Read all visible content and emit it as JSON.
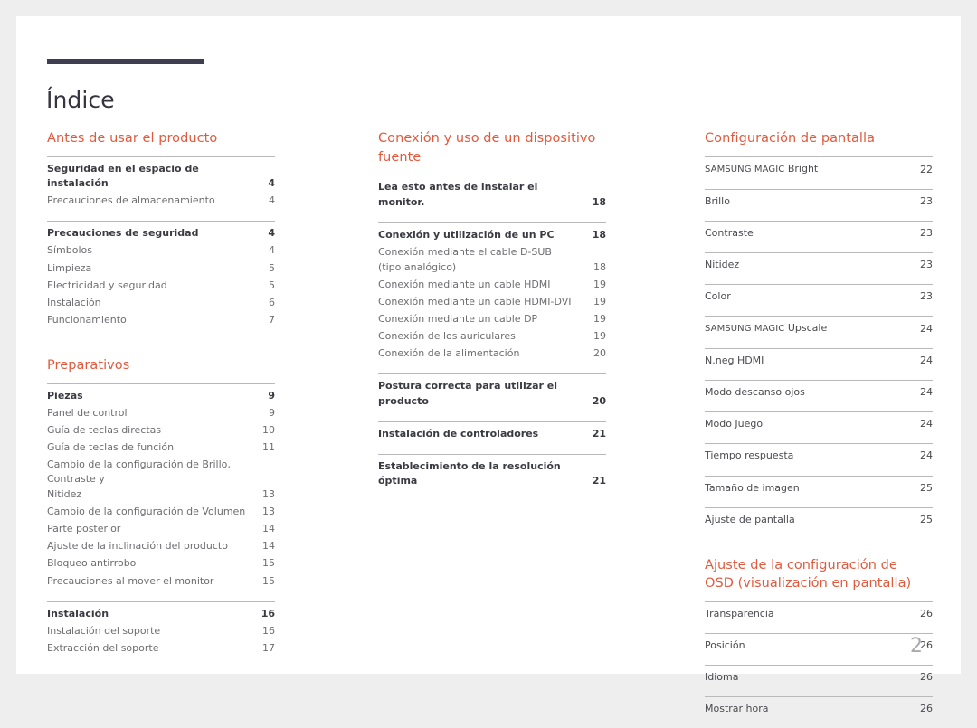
{
  "document": {
    "title": "Índice",
    "page_number": "2",
    "accent_color": "#e15a3e",
    "rule_color": "#3f3e50",
    "page_number_color": "#a9a9b0"
  },
  "columns": [
    {
      "name": "column-left",
      "sections": [
        {
          "heading": "Antes de usar el producto",
          "groups": [
            {
              "rows": [
                {
                  "label": "Seguridad en el espacio de instalación",
                  "page": "4",
                  "level": "head"
                },
                {
                  "label": "Precauciones de almacenamiento",
                  "page": "4",
                  "level": "sub"
                }
              ]
            },
            {
              "rows": [
                {
                  "label": "Precauciones de seguridad",
                  "page": "4",
                  "level": "head"
                },
                {
                  "label": "Símbolos",
                  "page": "4",
                  "level": "sub"
                },
                {
                  "label": "Limpieza",
                  "page": "5",
                  "level": "sub"
                },
                {
                  "label": "Electricidad y seguridad",
                  "page": "5",
                  "level": "sub"
                },
                {
                  "label": "Instalación",
                  "page": "6",
                  "level": "sub"
                },
                {
                  "label": "Funcionamiento",
                  "page": "7",
                  "level": "sub"
                }
              ]
            }
          ]
        },
        {
          "heading": "Preparativos",
          "groups": [
            {
              "rows": [
                {
                  "label": "Piezas",
                  "page": "9",
                  "level": "head"
                },
                {
                  "label": "Panel de control",
                  "page": "9",
                  "level": "sub"
                },
                {
                  "label": "Guía de teclas directas",
                  "page": "10",
                  "level": "sub"
                },
                {
                  "label": "Guía de teclas de función",
                  "page": "11",
                  "level": "sub"
                },
                {
                  "label": "Cambio de la configuración de Brillo, Contraste y\nNitidez",
                  "page": "13",
                  "level": "sub"
                },
                {
                  "label": "Cambio de la configuración de Volumen",
                  "page": "13",
                  "level": "sub"
                },
                {
                  "label": "Parte posterior",
                  "page": "14",
                  "level": "sub"
                },
                {
                  "label": "Ajuste de la inclinación del producto",
                  "page": "14",
                  "level": "sub"
                },
                {
                  "label": "Bloqueo antirrobo",
                  "page": "15",
                  "level": "sub"
                },
                {
                  "label": "Precauciones al mover el monitor",
                  "page": "15",
                  "level": "sub"
                }
              ]
            },
            {
              "rows": [
                {
                  "label": "Instalación",
                  "page": "16",
                  "level": "head"
                },
                {
                  "label": "Instalación del soporte",
                  "page": "16",
                  "level": "sub"
                },
                {
                  "label": "Extracción del soporte",
                  "page": "17",
                  "level": "sub"
                }
              ]
            }
          ]
        }
      ]
    },
    {
      "name": "column-middle",
      "sections": [
        {
          "heading": "Conexión y uso de un dispositivo fuente",
          "groups": [
            {
              "rows": [
                {
                  "label": "Lea esto antes de instalar el monitor.",
                  "page": "18",
                  "level": "head"
                }
              ]
            },
            {
              "rows": [
                {
                  "label": "Conexión y utilización de un PC",
                  "page": "18",
                  "level": "head"
                },
                {
                  "label": "Conexión mediante el cable D-SUB\n(tipo analógico)",
                  "page": "18",
                  "level": "sub"
                },
                {
                  "label": "Conexión mediante un cable HDMI",
                  "page": "19",
                  "level": "sub"
                },
                {
                  "label": "Conexión mediante un cable HDMI-DVI",
                  "page": "19",
                  "level": "sub"
                },
                {
                  "label": "Conexión mediante un cable DP",
                  "page": "19",
                  "level": "sub"
                },
                {
                  "label": "Conexión de los auriculares",
                  "page": "19",
                  "level": "sub"
                },
                {
                  "label": "Conexión de la alimentación",
                  "page": "20",
                  "level": "sub"
                }
              ]
            },
            {
              "rows": [
                {
                  "label": "Postura correcta para utilizar el producto",
                  "page": "20",
                  "level": "head"
                }
              ]
            },
            {
              "rows": [
                {
                  "label": "Instalación de controladores",
                  "page": "21",
                  "level": "head"
                }
              ]
            },
            {
              "rows": [
                {
                  "label": "Establecimiento de la resolución óptima",
                  "page": "21",
                  "level": "head"
                }
              ]
            }
          ]
        }
      ]
    },
    {
      "name": "column-right",
      "sections": [
        {
          "heading": "Configuración de pantalla",
          "groups": [
            {
              "rows": [
                {
                  "label": "SAMSUNG MAGIC Bright",
                  "page": "22",
                  "level": "plain"
                }
              ]
            },
            {
              "rows": [
                {
                  "label": "Brillo",
                  "page": "23",
                  "level": "plain"
                }
              ]
            },
            {
              "rows": [
                {
                  "label": "Contraste",
                  "page": "23",
                  "level": "plain"
                }
              ]
            },
            {
              "rows": [
                {
                  "label": "Nitidez",
                  "page": "23",
                  "level": "plain"
                }
              ]
            },
            {
              "rows": [
                {
                  "label": "Color",
                  "page": "23",
                  "level": "plain"
                }
              ]
            },
            {
              "rows": [
                {
                  "label": "SAMSUNG MAGIC Upscale",
                  "page": "24",
                  "level": "plain"
                }
              ]
            },
            {
              "rows": [
                {
                  "label": "N.neg HDMI",
                  "page": "24",
                  "level": "plain"
                }
              ]
            },
            {
              "rows": [
                {
                  "label": "Modo descanso ojos",
                  "page": "24",
                  "level": "plain"
                }
              ]
            },
            {
              "rows": [
                {
                  "label": "Modo Juego",
                  "page": "24",
                  "level": "plain"
                }
              ]
            },
            {
              "rows": [
                {
                  "label": "Tiempo respuesta",
                  "page": "24",
                  "level": "plain"
                }
              ]
            },
            {
              "rows": [
                {
                  "label": "Tamaño de imagen",
                  "page": "25",
                  "level": "plain"
                }
              ]
            },
            {
              "rows": [
                {
                  "label": "Ajuste de pantalla",
                  "page": "25",
                  "level": "plain"
                }
              ]
            }
          ]
        },
        {
          "heading": "Ajuste de la configuración de\nOSD (visualización en pantalla)",
          "groups": [
            {
              "rows": [
                {
                  "label": "Transparencia",
                  "page": "26",
                  "level": "plain"
                }
              ]
            },
            {
              "rows": [
                {
                  "label": "Posición",
                  "page": "26",
                  "level": "plain"
                }
              ]
            },
            {
              "rows": [
                {
                  "label": "Idioma",
                  "page": "26",
                  "level": "plain"
                }
              ]
            },
            {
              "rows": [
                {
                  "label": "Mostrar hora",
                  "page": "26",
                  "level": "plain"
                }
              ]
            }
          ]
        }
      ]
    }
  ]
}
